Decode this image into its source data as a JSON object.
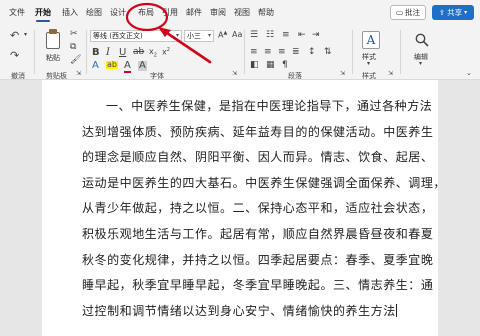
{
  "menu": {
    "tabs": [
      {
        "label": "文件"
      },
      {
        "label": "开始"
      },
      {
        "label": "插入"
      },
      {
        "label": "绘图"
      },
      {
        "label": "设计"
      },
      {
        "label": "布局"
      },
      {
        "label": "引用"
      },
      {
        "label": "邮件"
      },
      {
        "label": "审阅"
      },
      {
        "label": "视图"
      },
      {
        "label": "帮助"
      }
    ],
    "active_tab": "开始",
    "comment_label": "批注",
    "share_label": "共享"
  },
  "ribbon": {
    "paste_label": "粘贴",
    "font_name": "等线 (西文正文)",
    "font_size": "小三",
    "styles_label": "样式",
    "editing_label": "编辑",
    "groups": {
      "undo": "撤消",
      "clipboard": "剪贴板",
      "font": "字体",
      "paragraph": "段落",
      "styles": "样式"
    }
  },
  "colors": {
    "accent": "#2b579a",
    "share": "#1e6fc8",
    "highlight_circle": "#d0021b"
  },
  "document": {
    "lines": [
      "一、中医养生保健，是指在中医理论指导下，通过各种方法",
      "达到增强体质、预防疾病、延年益寿目的的保健活动。中医养生",
      "的理念是顺应自然、阴阳平衡、因人而异。情志、饮食、起居、",
      "运动是中医养生的四大基石。中医养生保健强调全面保养、调理，",
      "从青少年做起，持之以恒。二、保持心态平和，适应社会状态，",
      "积极乐观地生活与工作。起居有常，顺应自然界晨昏昼夜和春夏",
      "秋冬的变化规律，并持之以恒。四季起居要点：春季、夏季宜晚",
      "睡早起，秋季宜早睡早起，冬季宜早睡晚起。三、情志养生：通",
      "过控制和调节情绪以达到身心安宁、情绪愉快的养生方法"
    ]
  }
}
